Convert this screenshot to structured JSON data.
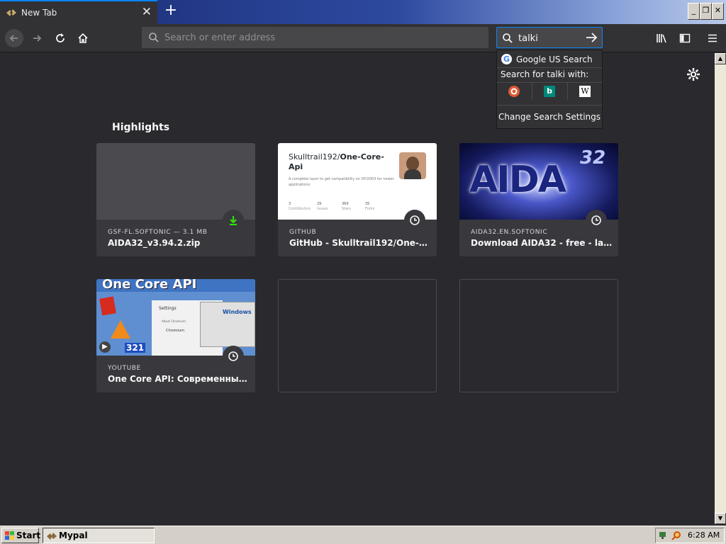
{
  "tab": {
    "title": "New Tab",
    "close": "✕",
    "new_tab": "+"
  },
  "window_controls": {
    "minimize": "_",
    "restore": "❐",
    "close": "✕"
  },
  "navbar": {
    "url_placeholder": "Search or enter address",
    "search_value": "talki"
  },
  "search_dropdown": {
    "default_engine": "Google US Search",
    "search_for_label": "Search for talki with:",
    "engines": [
      "duckduckgo-icon",
      "bing-icon",
      "wikipedia-icon"
    ],
    "bing_glyph": "b",
    "wiki_glyph": "W",
    "settings_label": "Change Search Settings"
  },
  "content": {
    "section_title": "Highlights",
    "cards": [
      {
        "source": "GSF-FL.SOFTONIC — 3.1 MB",
        "title": "AIDA32_v3.94.2.zip",
        "badge": "download-icon"
      },
      {
        "source": "GITHUB",
        "title": "GitHub - Skulltrail192/One-Core-...",
        "badge": "clock-icon",
        "thumb_heading_plain": "Skulltrail192/",
        "thumb_heading_bold": "One-Core-",
        "thumb_heading_bold2": "Api",
        "thumb_desc": "A complete layer to get compatibility on XP/2003 for newer applications",
        "thumb_stats": [
          {
            "value": "3",
            "label": "Contributors"
          },
          {
            "value": "29",
            "label": "Issues"
          },
          {
            "value": "369",
            "label": "Stars"
          },
          {
            "value": "35",
            "label": "Forks"
          }
        ]
      },
      {
        "source": "AIDA32.EN.SOFTONIC",
        "title": "Download AIDA32 - free - latest ...",
        "badge": "clock-icon",
        "thumb_text": "AIDA",
        "thumb_number": "32"
      },
      {
        "source": "YOUTUBE",
        "title": "One Core API: Современные пр...",
        "badge": "clock-icon",
        "thumb_text": "One Core API",
        "thumb_settings": "Settings",
        "thumb_about": "About Chromium",
        "thumb_chromium": "Chromium",
        "thumb_windows": "Windows",
        "thumb_num": "321"
      }
    ]
  },
  "taskbar": {
    "start_label": "Start",
    "task_label": "Mypal",
    "clock": "6:28 AM"
  },
  "scrollbar": {
    "up": "▲",
    "down": "▼"
  },
  "colors": {
    "accent": "#0a84ff",
    "background": "#2a2a2e",
    "toolbar": "#323234",
    "download_green": "#30e60b"
  }
}
